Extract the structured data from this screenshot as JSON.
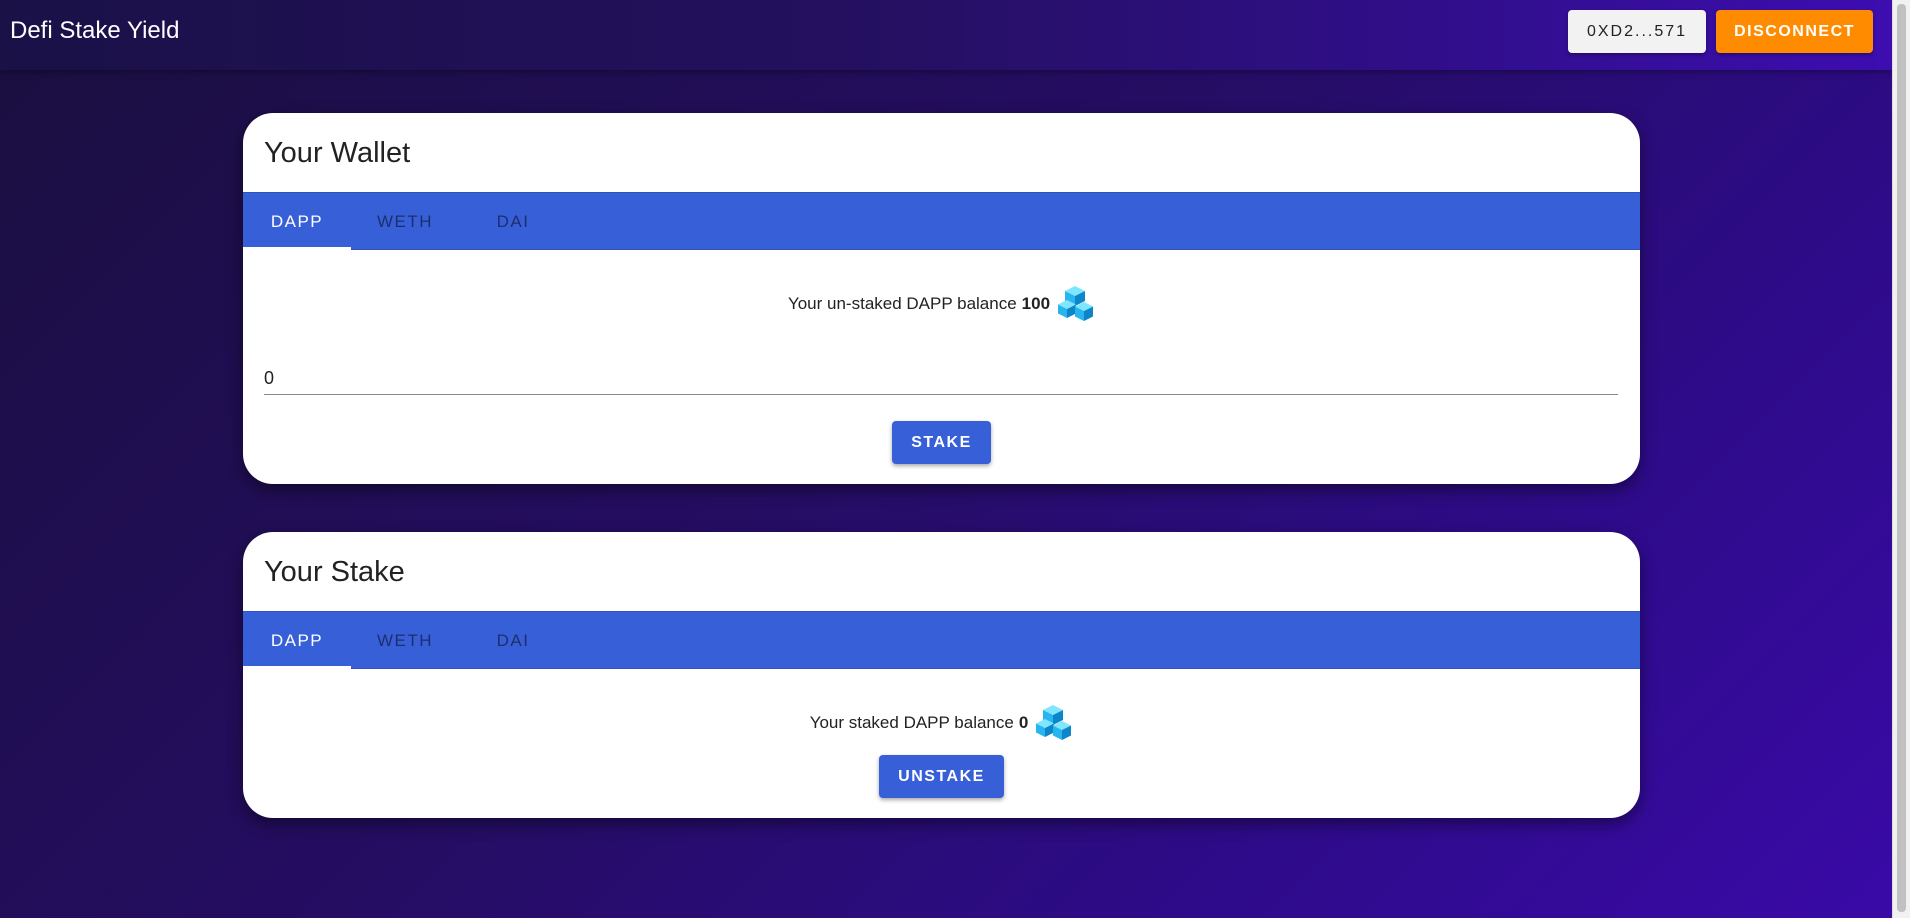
{
  "app": {
    "title": "Defi Stake Yield",
    "address_label": "0XD2...571",
    "disconnect_label": "DISCONNECT"
  },
  "wallet": {
    "title": "Your Wallet",
    "tabs": [
      {
        "label": "DAPP",
        "active": true
      },
      {
        "label": "WETH",
        "active": false
      },
      {
        "label": "DAI",
        "active": false
      }
    ],
    "balance_text": "Your un-staked DAPP balance",
    "balance_value": "100",
    "token_icon": "dapp-token-icon",
    "input_value": "0",
    "stake_label": "STAKE"
  },
  "stake": {
    "title": "Your Stake",
    "tabs": [
      {
        "label": "DAPP",
        "active": true
      },
      {
        "label": "WETH",
        "active": false
      },
      {
        "label": "DAI",
        "active": false
      }
    ],
    "balance_text": "Your staked DAPP balance",
    "balance_value": "0",
    "token_icon": "dapp-token-icon",
    "unstake_label": "UNSTAKE"
  },
  "colors": {
    "primary": "#3760d8",
    "accent": "#ff8c00",
    "appbar": "#24105f"
  }
}
